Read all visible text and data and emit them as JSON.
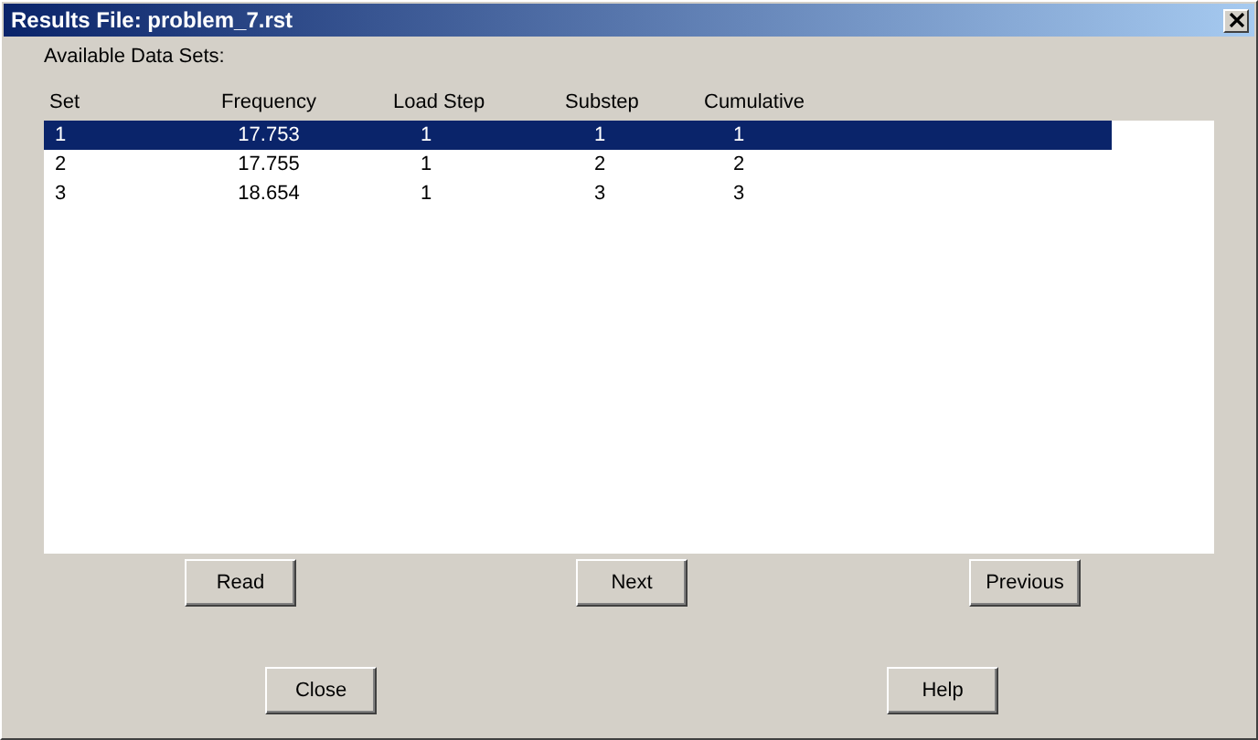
{
  "window": {
    "title": "Results File: problem_7.rst"
  },
  "list_label": "Available Data Sets:",
  "table": {
    "columns": [
      "Set",
      "Frequency",
      "Load Step",
      "Substep",
      "Cumulative"
    ],
    "rows": [
      {
        "cells": [
          "1",
          "17.753",
          "1",
          "1",
          "1"
        ],
        "selected": true
      },
      {
        "cells": [
          "2",
          "17.755",
          "1",
          "2",
          "2"
        ],
        "selected": false
      },
      {
        "cells": [
          "3",
          "18.654",
          "1",
          "3",
          "3"
        ],
        "selected": false
      }
    ]
  },
  "nav_buttons": [
    "Read",
    "Next",
    "Previous"
  ],
  "footer_buttons": [
    "Close",
    "Help"
  ]
}
